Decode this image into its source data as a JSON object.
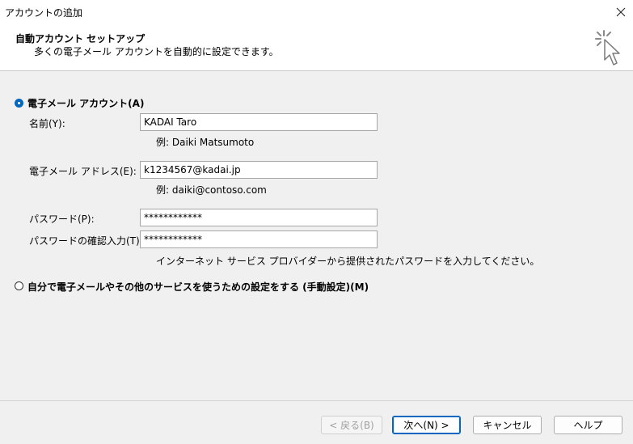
{
  "window": {
    "title": "アカウントの追加",
    "close_icon": "close-icon"
  },
  "header": {
    "title": "自動アカウント セットアップ",
    "subtitle": "多くの電子メール アカウントを自動的に設定できます。",
    "icon": "wizard-cursor-icon"
  },
  "email_option": {
    "label": "電子メール アカウント(A)",
    "selected": true,
    "name_label": "名前(Y):",
    "name_value": "KADAI Taro",
    "name_example": "例: Daiki Matsumoto",
    "email_label": "電子メール アドレス(E):",
    "email_value": "k1234567@kadai.jp",
    "email_example": "例: daiki@contoso.com",
    "password_label": "パスワード(P):",
    "password_value": "************",
    "confirm_label": "パスワードの確認入力(T):",
    "confirm_value": "************",
    "password_hint": "インターネット サービス プロバイダーから提供されたパスワードを入力してください。"
  },
  "manual_option": {
    "label": "自分で電子メールやその他のサービスを使うための設定をする (手動設定)(M)",
    "selected": false
  },
  "buttons": {
    "back": "< 戻る(B)",
    "next": "次へ(N) >",
    "cancel": "キャンセル",
    "help": "ヘルプ"
  },
  "colors": {
    "accent": "#0067c0",
    "background": "#f0f0f0"
  }
}
